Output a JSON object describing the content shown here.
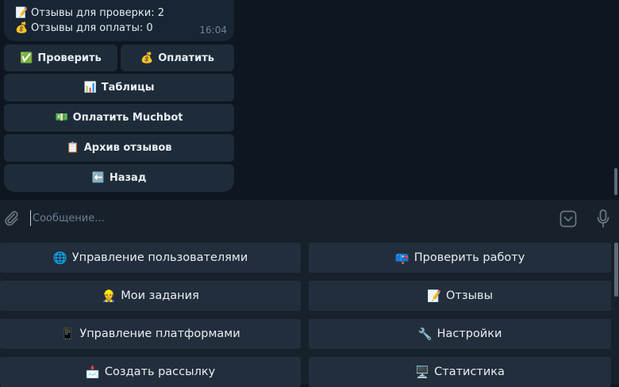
{
  "message": {
    "lines": [
      {
        "emoji": "📝",
        "text": "Отзывы для проверки: 2"
      },
      {
        "emoji": "💰",
        "text": "Отзывы для оплаты: 0"
      }
    ],
    "time": "16:04"
  },
  "inline_keyboard": {
    "check": {
      "emoji": "✅",
      "label": "Проверить"
    },
    "pay": {
      "emoji": "💰",
      "label": "Оплатить"
    },
    "tables": {
      "emoji": "📊",
      "label": "Таблицы"
    },
    "muchbot": {
      "emoji": "💵",
      "label": "Оплатить Muchbot"
    },
    "archive": {
      "emoji": "📋",
      "label": "Архив отзывов"
    },
    "back": {
      "emoji": "⬅️",
      "label": "Назад"
    }
  },
  "composer": {
    "placeholder": "Сообщение..."
  },
  "reply_keyboard": {
    "users": {
      "emoji": "🌐",
      "label": "Управление пользователями"
    },
    "check_work": {
      "emoji": "📪",
      "label": "Проверить работу"
    },
    "my_tasks": {
      "emoji": "👷",
      "label": "Мои задания"
    },
    "reviews": {
      "emoji": "📝",
      "label": "Отзывы"
    },
    "platforms": {
      "emoji": "📱",
      "label": "Управление платформами"
    },
    "settings": {
      "emoji": "🔧",
      "label": "Настройки"
    },
    "broadcast": {
      "emoji": "📩",
      "label": "Создать рассылку"
    },
    "stats": {
      "emoji": "🖥️",
      "label": "Статистика"
    }
  },
  "colors": {
    "background": "#0e1621",
    "bubble": "#182533",
    "panel": "#17212b",
    "button": "#232e3c"
  }
}
